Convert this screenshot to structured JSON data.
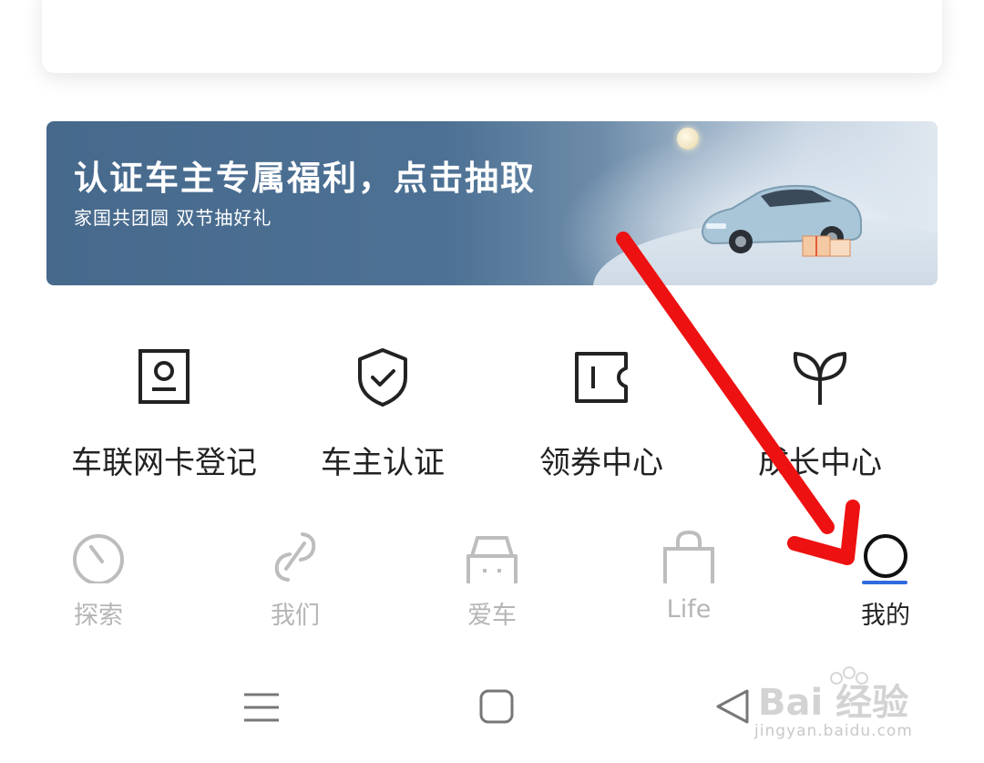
{
  "banner": {
    "title": "认证车主专属福利，点击抽取",
    "subtitle": "家国共团圆  双节抽好礼"
  },
  "quick_actions": [
    {
      "label": "车联网卡登记",
      "icon": "id-card-icon"
    },
    {
      "label": "车主认证",
      "icon": "shield-check-icon"
    },
    {
      "label": "领券中心",
      "icon": "coupon-icon"
    },
    {
      "label": "成长中心",
      "icon": "sprout-icon"
    }
  ],
  "tabs": [
    {
      "label": "探索",
      "icon": "compass-icon",
      "active": false
    },
    {
      "label": "我们",
      "icon": "link-icon",
      "active": false
    },
    {
      "label": "爱车",
      "icon": "car-icon",
      "active": false
    },
    {
      "label": "Life",
      "icon": "shopping-bag-icon",
      "active": false
    },
    {
      "label": "我的",
      "icon": "profile-circle-icon",
      "active": true
    }
  ],
  "nav": {
    "menu_icon": "menu-icon",
    "home_icon": "home-square-icon",
    "back_icon": "back-triangle-icon"
  },
  "watermark": {
    "brand": "Bai 经验",
    "url": "jingyan.baidu.com"
  },
  "colors": {
    "accent": "#2f6bdb",
    "annotation_arrow": "#ee1111",
    "banner": "#4d7194",
    "inactive_tab": "#b5b5b5"
  }
}
